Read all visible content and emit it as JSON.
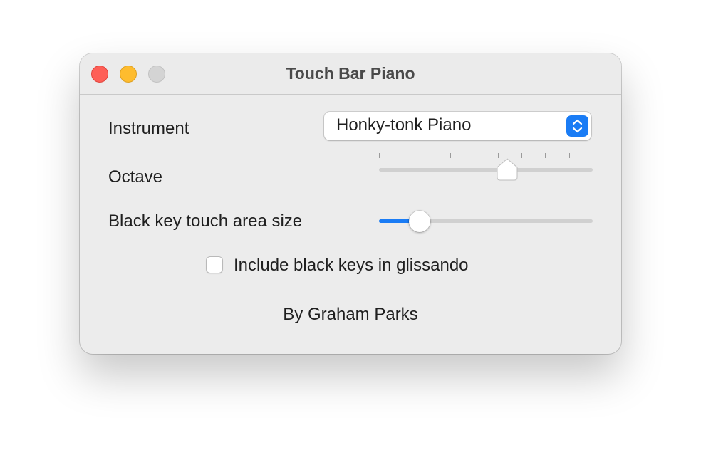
{
  "window": {
    "title": "Touch Bar Piano",
    "controls": [
      "close",
      "minimize",
      "zoom"
    ],
    "colors": {
      "close": "#fe5f57",
      "minimize": "#febc2e",
      "zoom_inactive": "#d4d4d4",
      "accent": "#1a7cf5"
    }
  },
  "instrument": {
    "label": "Instrument",
    "selected": "Honky-tonk Piano",
    "arrows_icon": "up-down-chevron-icon"
  },
  "octave": {
    "label": "Octave",
    "tick_count": 10,
    "value_fraction": 0.6
  },
  "black_key": {
    "label": "Black key touch area size",
    "value_fraction": 0.19
  },
  "glissando": {
    "label": "Include black keys in glissando",
    "checked": false
  },
  "footer": {
    "credit": "By Graham Parks"
  }
}
